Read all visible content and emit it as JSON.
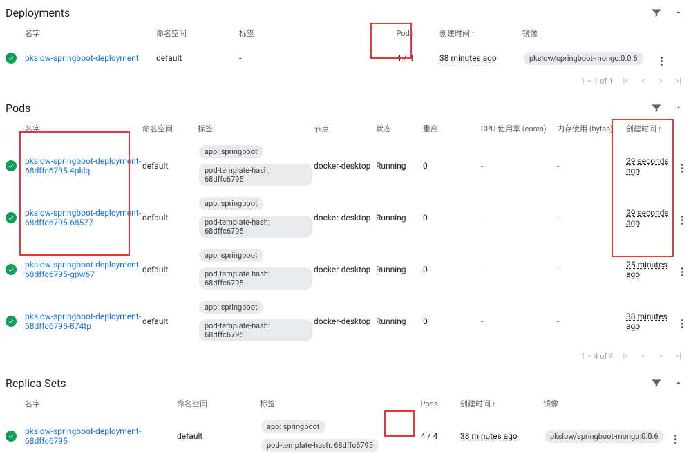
{
  "deployments": {
    "title": "Deployments",
    "headers": {
      "name": "名字",
      "namespace": "命名空间",
      "labels": "标签",
      "pods": "Pods",
      "created": "创建时间",
      "image": "镜像"
    },
    "row": {
      "name": "pkslow-springboot-deployment",
      "namespace": "default",
      "labels": "-",
      "pods": "4 / 4",
      "created": "38 minutes ago",
      "image": "pkslow/springboot-mongo:0.0.6"
    },
    "pager": "1 – 1 of 1"
  },
  "pods": {
    "title": "Pods",
    "headers": {
      "name": "名字",
      "namespace": "命名空间",
      "labels": "标签",
      "node": "节点",
      "status": "状态",
      "restarts": "重启",
      "cpu": "CPU 使用率 (cores)",
      "memory": "内存使用 (bytes)",
      "created": "创建时间"
    },
    "labelChips": {
      "app": "app: springboot",
      "hash": "pod-template-hash: 68dffc6795"
    },
    "rows": [
      {
        "name": "pkslow-springboot-deployment-68dffc6795-4pklq",
        "namespace": "default",
        "node": "docker-desktop",
        "status": "Running",
        "restarts": "0",
        "cpu": "-",
        "memory": "-",
        "created": "29 seconds ago"
      },
      {
        "name": "pkslow-springboot-deployment-68dffc6795-68577",
        "namespace": "default",
        "node": "docker-desktop",
        "status": "Running",
        "restarts": "0",
        "cpu": "-",
        "memory": "-",
        "created": "29 seconds ago"
      },
      {
        "name": "pkslow-springboot-deployment-68dffc6795-gpw67",
        "namespace": "default",
        "node": "docker-desktop",
        "status": "Running",
        "restarts": "0",
        "cpu": "-",
        "memory": "-",
        "created": "25 minutes ago"
      },
      {
        "name": "pkslow-springboot-deployment-68dffc6795-874tp",
        "namespace": "default",
        "node": "docker-desktop",
        "status": "Running",
        "restarts": "0",
        "cpu": "-",
        "memory": "-",
        "created": "38 minutes ago"
      }
    ],
    "pager": "1 – 4 of 4"
  },
  "replicasets": {
    "title": "Replica Sets",
    "headers": {
      "name": "名字",
      "namespace": "命名空间",
      "labels": "标签",
      "pods": "Pods",
      "created": "创建时间",
      "image": "镜像"
    },
    "labelChips": {
      "app": "app: springboot",
      "hash": "pod-template-hash: 68dffc6795"
    },
    "row": {
      "name": "pkslow-springboot-deployment-68dffc6795",
      "namespace": "default",
      "pods": "4 / 4",
      "created": "38 minutes ago",
      "image": "pkslow/springboot-mongo:0.0.6"
    }
  }
}
